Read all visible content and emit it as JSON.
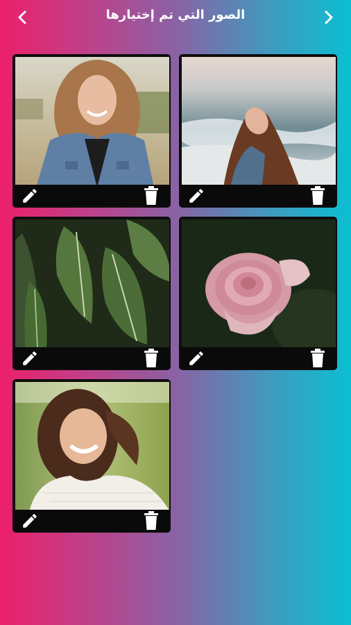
{
  "header": {
    "title": "الصور التي تم إختيارها",
    "back_icon": "chevron-left-icon",
    "forward_icon": "chevron-right-icon"
  },
  "photos": [
    {
      "subject": "woman-denim-jacket-field",
      "edit_icon": "pencil-icon",
      "delete_icon": "trash-icon"
    },
    {
      "subject": "woman-beach-waves",
      "edit_icon": "pencil-icon",
      "delete_icon": "trash-icon"
    },
    {
      "subject": "tropical-leaves",
      "edit_icon": "pencil-icon",
      "delete_icon": "trash-icon"
    },
    {
      "subject": "pink-rose",
      "edit_icon": "pencil-icon",
      "delete_icon": "trash-icon"
    },
    {
      "subject": "laughing-woman-outdoors",
      "edit_icon": "pencil-icon",
      "delete_icon": "trash-icon"
    }
  ],
  "colors": {
    "gradient_left": "#ec1f6a",
    "gradient_right": "#0bbfd2",
    "card_bg": "#0d0d0d",
    "icon": "#ffffff"
  }
}
